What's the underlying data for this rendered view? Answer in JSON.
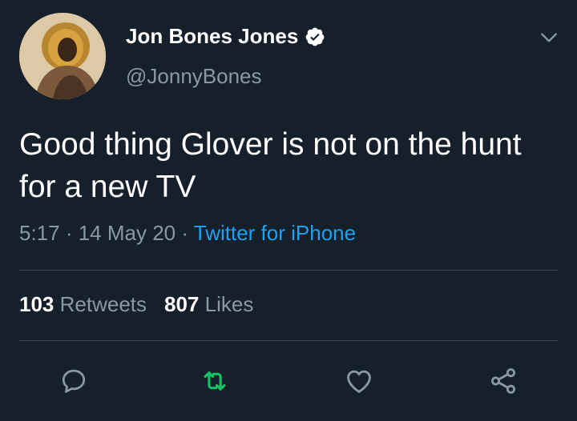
{
  "author": {
    "name": "Jon Bones Jones",
    "handle": "@JonnyBones",
    "verified": true
  },
  "tweet": {
    "text": "Good thing Glover is not on the hunt for a new TV"
  },
  "meta": {
    "time": "5:17",
    "separator1": " · ",
    "date": "14 May 20",
    "separator2": " · ",
    "source": "Twitter for iPhone"
  },
  "stats": {
    "retweets_count": "103",
    "retweets_label": "Retweets",
    "likes_count": "807",
    "likes_label": "Likes"
  },
  "actions": {
    "reply_icon": "reply-icon",
    "retweet_icon": "retweet-icon",
    "like_icon": "heart-icon",
    "share_icon": "share-icon"
  },
  "colors": {
    "background": "#15202b",
    "text_primary": "#ffffff",
    "text_secondary": "#8899a6",
    "link": "#1da1f2",
    "retweet_active": "#17bf63",
    "divider": "#38444d"
  }
}
